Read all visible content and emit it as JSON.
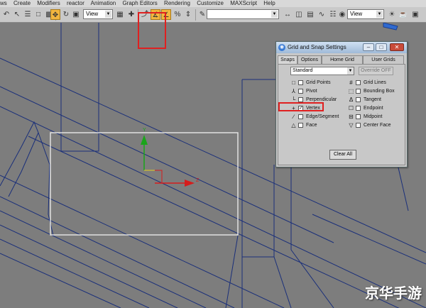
{
  "menu": [
    "ws",
    "Create",
    "Modifiers",
    "reactor",
    "Animation",
    "Graph Editors",
    "Rendering",
    "Customize",
    "MAXScript",
    "Help"
  ],
  "toolbar": {
    "view_select": "View",
    "view_select2": "View",
    "named_sets": ""
  },
  "viewport": {
    "axis_y": "Y",
    "axis_z": "Z"
  },
  "dialog": {
    "title": "Grid and Snap Settings",
    "win_min": "–",
    "win_max": "□",
    "win_close": "✕",
    "tabs": [
      "Snaps",
      "Options",
      "Home Grid",
      "User Grids"
    ],
    "active_tab": "Snaps",
    "snap_set": "Standard",
    "override_label": "Override OFF",
    "left_snaps": [
      {
        "label": "Grid Points",
        "checked": false,
        "symbol": "□"
      },
      {
        "label": "Pivot",
        "checked": false,
        "symbol": "⅄"
      },
      {
        "label": "Perpendicular",
        "checked": false,
        "symbol": "└"
      },
      {
        "label": "Vertex",
        "checked": true,
        "symbol": "+"
      },
      {
        "label": "Edge/Segment",
        "checked": false,
        "symbol": "∕"
      },
      {
        "label": "Face",
        "checked": false,
        "symbol": "△"
      }
    ],
    "right_snaps": [
      {
        "label": "Grid Lines",
        "checked": false,
        "symbol": "#"
      },
      {
        "label": "Bounding Box",
        "checked": false,
        "symbol": "⬚"
      },
      {
        "label": "Tangent",
        "checked": false,
        "symbol": "Δ"
      },
      {
        "label": "Endpoint",
        "checked": false,
        "symbol": "☐"
      },
      {
        "label": "Midpoint",
        "checked": false,
        "symbol": "⊟"
      },
      {
        "label": "Center Face",
        "checked": false,
        "symbol": "▽"
      }
    ],
    "clear_all": "Clear All"
  },
  "watermark": "京华手游",
  "colors": {
    "highlight": "#e02020",
    "wire": "#1a2f7a",
    "selection": "#e8e8e8",
    "axis_green": "#1aa51a",
    "axis_red": "#d61c1c",
    "snap_active": "#f2b640"
  }
}
